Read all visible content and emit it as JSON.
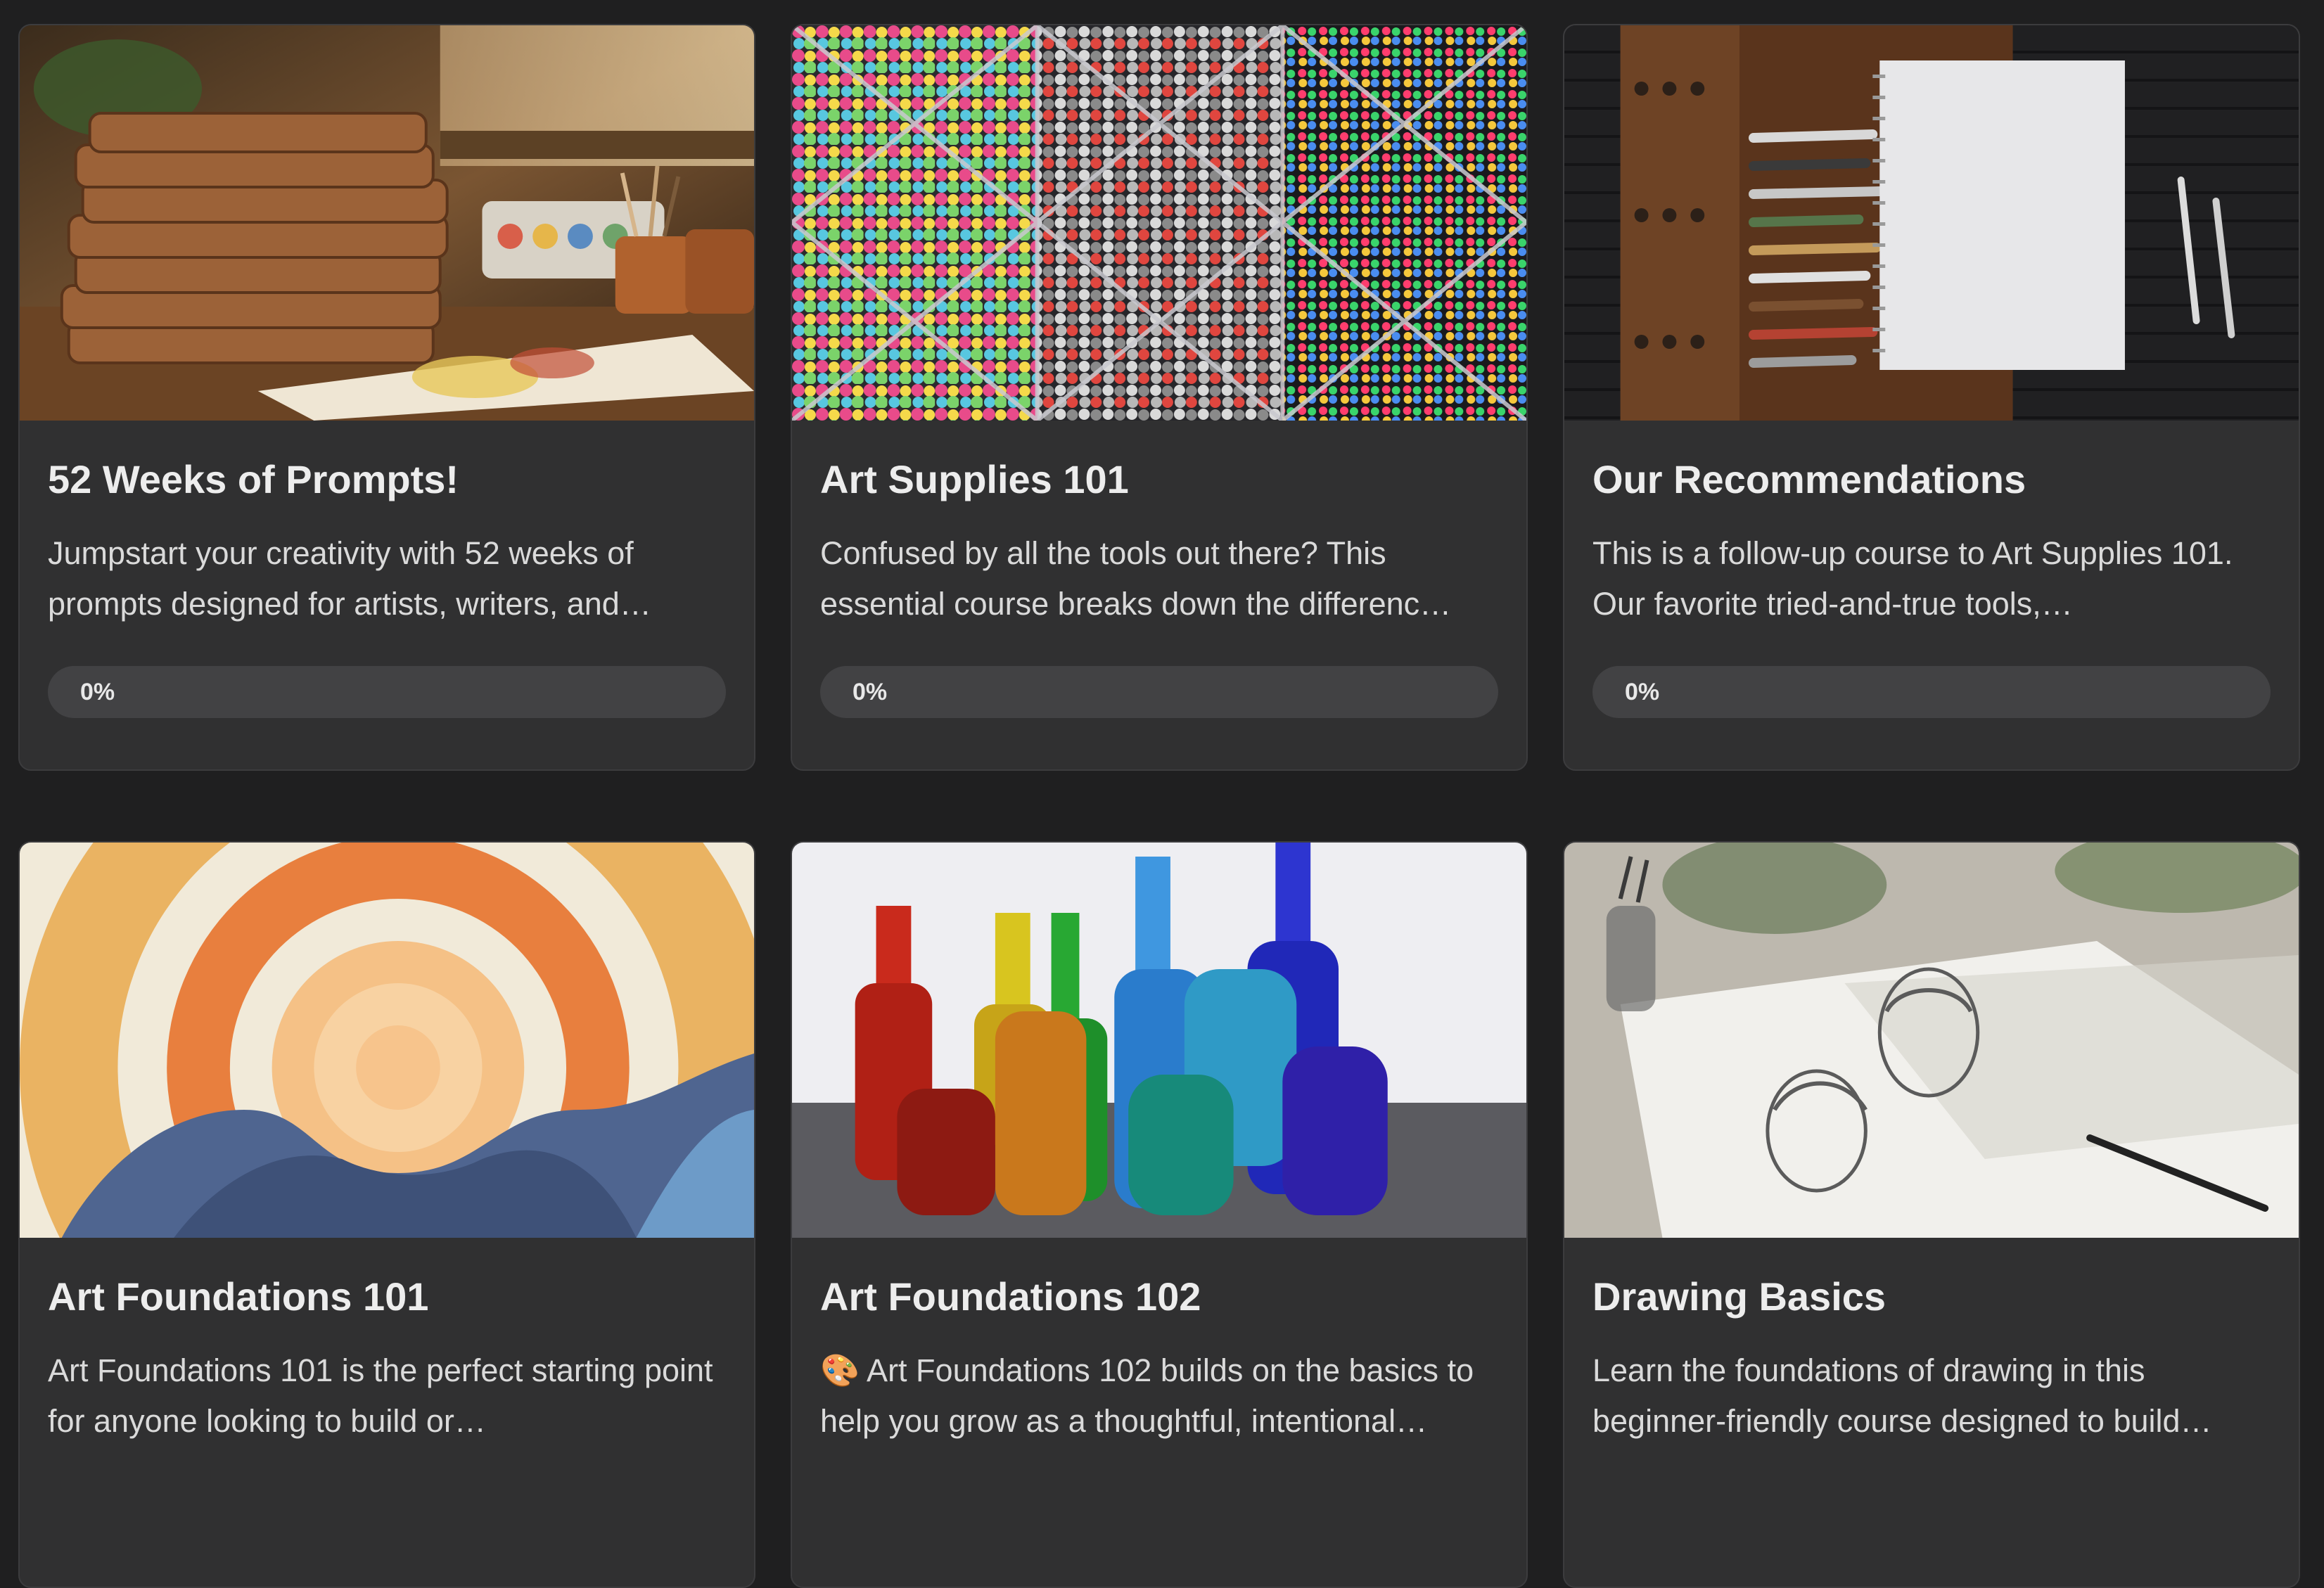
{
  "courses": [
    {
      "title": "52 Weeks of Prompts!",
      "description": "Jumpstart your creativity with 52 weeks of prompts designed for artists, writers, and…",
      "progress_label": "0%",
      "progress": 0,
      "image": "sketchbooks-on-desk"
    },
    {
      "title": "Art Supplies 101",
      "description": "Confused by all the tools out there? This essential course breaks down the differenc…",
      "progress_label": "0%",
      "progress": 0,
      "image": "marker-organizer"
    },
    {
      "title": "Our Recommendations",
      "description": "This is a follow-up course to Art Supplies 101. Our favorite tried-and-true tools,…",
      "progress_label": "0%",
      "progress": 0,
      "image": "sketchbook-and-pencil-roll"
    },
    {
      "title": "Art Foundations 101",
      "description": "Art Foundations 101 is the perfect starting point for anyone looking to build or…",
      "image": "watercolor-sun"
    },
    {
      "title": "Art Foundations 102",
      "description": "🎨 Art Foundations 102 builds on the basics to help you grow as a thoughtful, intentional…",
      "image": "colored-glass-bottles"
    },
    {
      "title": "Drawing Basics",
      "description": "Learn the foundations of drawing in this beginner-friendly course designed to build…",
      "image": "portrait-sketches"
    }
  ],
  "colors": {
    "background": "#1f1f20",
    "card": "#303031",
    "progress_track": "#424244"
  }
}
